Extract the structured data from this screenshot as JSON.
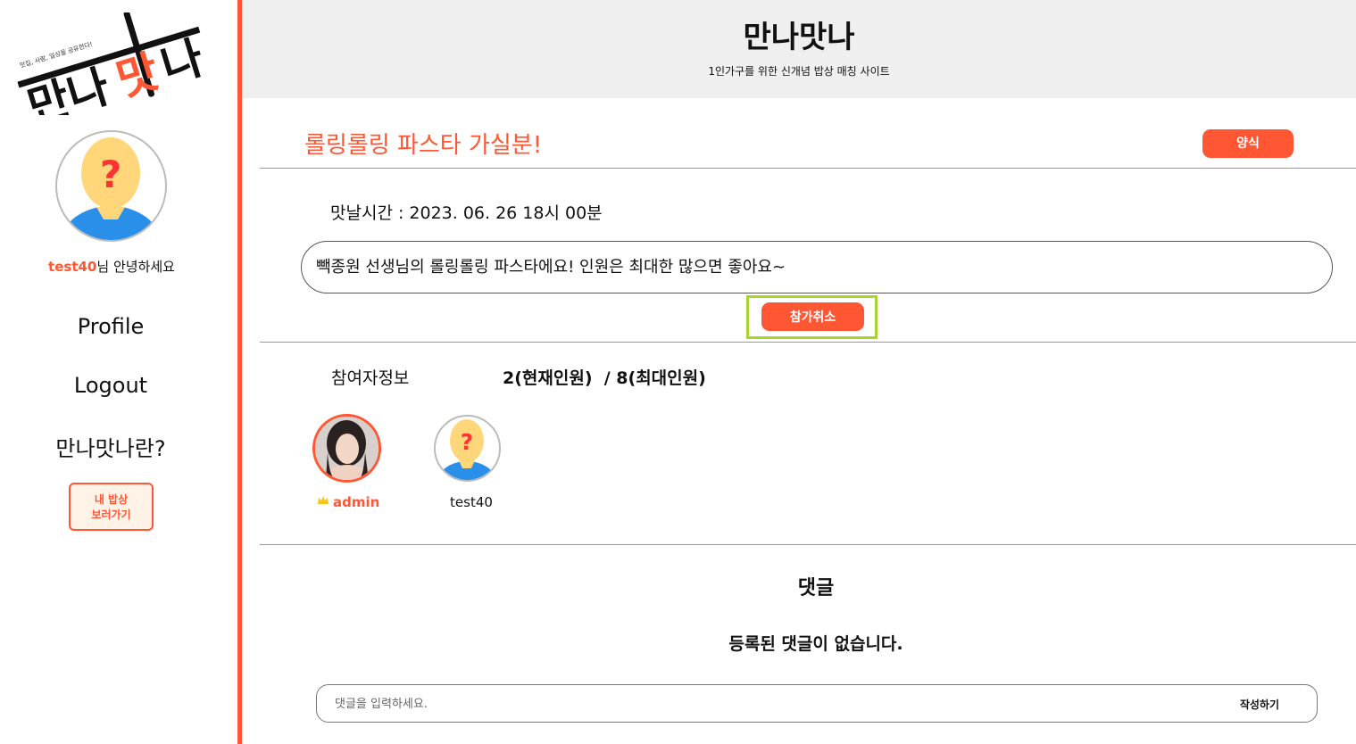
{
  "sidebar": {
    "logo": {
      "text": "만나맛나",
      "tagline": "맛집, 사람, 일상을 공유한다!",
      "accent_color": "#ff5733"
    },
    "user": {
      "username": "test40",
      "greeting_suffix": "님 안녕하세요"
    },
    "nav": [
      {
        "label": "Profile"
      },
      {
        "label": "Logout"
      },
      {
        "label": "만나맛나란?"
      }
    ],
    "my_meal_button": {
      "line1": "내 밥상",
      "line2": "보러가기"
    }
  },
  "header": {
    "title": "만나맛나",
    "subtitle": "1인가구를 위한 신개념 밥상 매칭 사이트"
  },
  "post": {
    "title": "롤링롤링 파스타 가실분!",
    "category": "양식",
    "meet_time": "맛날시간 : 2023. 06. 26 18시 00분",
    "description": "빽종원 선생님의 롤링롤링 파스타에요! 인원은 최대한 많으면 좋아요~",
    "cancel_button": "참가취소"
  },
  "participants": {
    "label": "참여자정보",
    "count_text": "2(현재인원)  / 8(최대인원)",
    "list": [
      {
        "name": "admin",
        "role": "host",
        "avatar": "photo-avatar"
      },
      {
        "name": "test40",
        "role": "member",
        "avatar": "default-avatar"
      }
    ]
  },
  "comments": {
    "title": "댓글",
    "empty_text": "등록된 댓글이 없습니다.",
    "input_placeholder": "댓글을 입력하세요.",
    "submit_label": "작성하기"
  },
  "colors": {
    "accent": "#ff5733",
    "highlight": "#a6d62a",
    "header_bg": "#efefef"
  }
}
